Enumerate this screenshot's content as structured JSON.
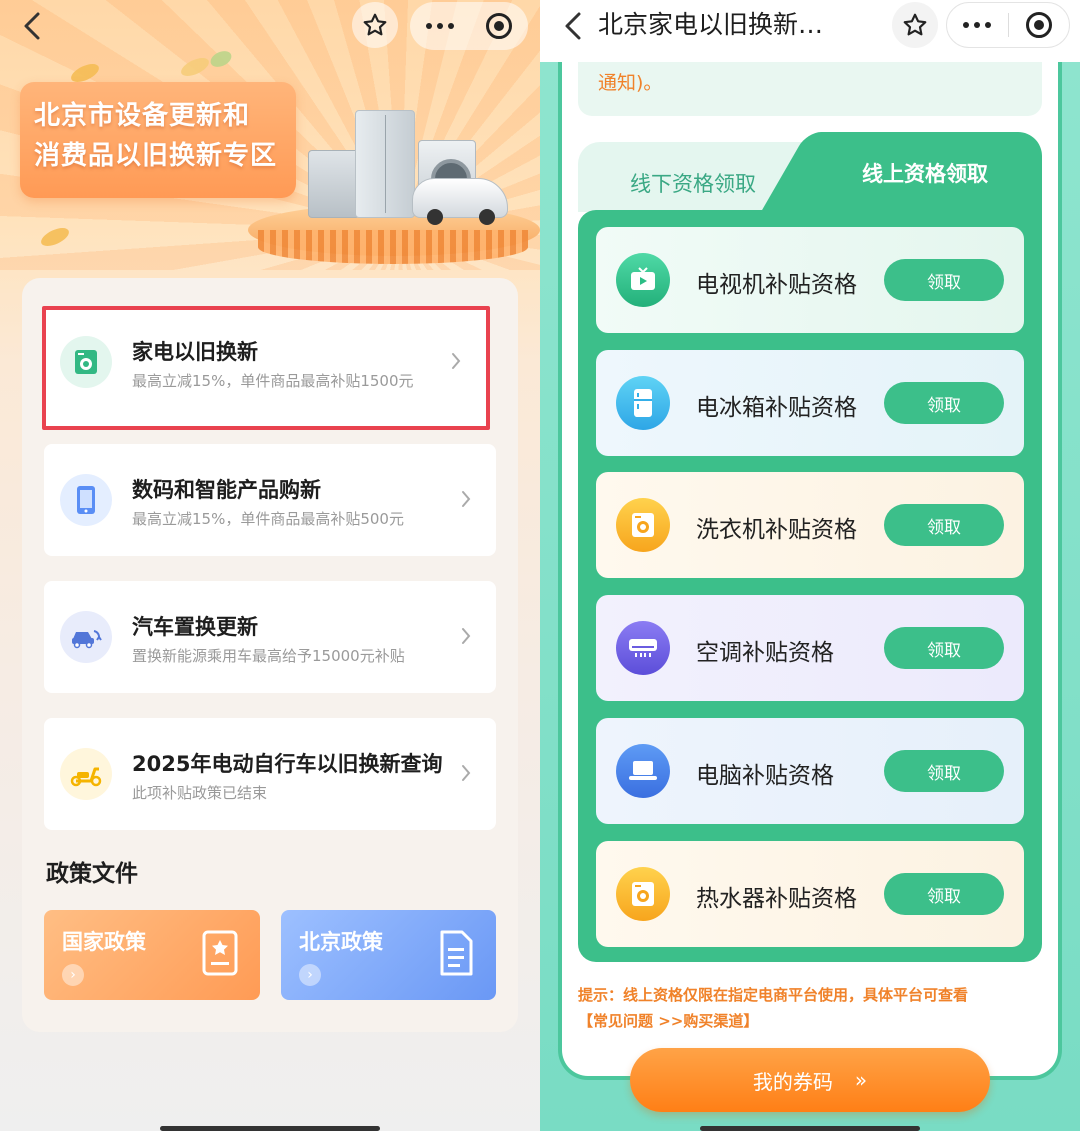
{
  "left": {
    "banner_lines": [
      "北京市设备更新和",
      "消费品以旧换新专区"
    ],
    "items": [
      {
        "title": "家电以旧换新",
        "sub": "最高立减15%，单件商品最高补贴1500元"
      },
      {
        "title": "数码和智能产品购新",
        "sub": "最高立减15%，单件商品最高补贴500元"
      },
      {
        "title": "汽车置换更新",
        "sub": "置换新能源乘用车最高给予15000元补贴"
      },
      {
        "title": "2025年电动自行车以旧换新查询",
        "sub": "此项补贴政策已结束"
      }
    ],
    "policy_heading": "政策文件",
    "policies": [
      {
        "label": "国家政策"
      },
      {
        "label": "北京政策"
      }
    ]
  },
  "right": {
    "title": "北京家电以旧换新…",
    "notice_text": "通知)。",
    "tabs": {
      "offline": "线下资格领取",
      "online": "线上资格领取"
    },
    "claim_label": "领取",
    "items": [
      {
        "label": "电视机补贴资格",
        "icon": "tv-icon"
      },
      {
        "label": "电冰箱补贴资格",
        "icon": "fridge-icon"
      },
      {
        "label": "洗衣机补贴资格",
        "icon": "washer-icon"
      },
      {
        "label": "空调补贴资格",
        "icon": "air-conditioner-icon"
      },
      {
        "label": "电脑补贴资格",
        "icon": "laptop-icon"
      },
      {
        "label": "热水器补贴资格",
        "icon": "water-heater-icon"
      }
    ],
    "tip_line1": "提示：线上资格仅限在指定电商平台使用，具体平台可查看",
    "tip_line2": "【常见问题 >>购买渠道】",
    "my_code": "我的券码",
    "my_code_arrow": "»"
  },
  "colors": {
    "accent_green": "#3cbf8a",
    "accent_orange": "#ff8a2a",
    "highlight_red": "#e9424f"
  }
}
